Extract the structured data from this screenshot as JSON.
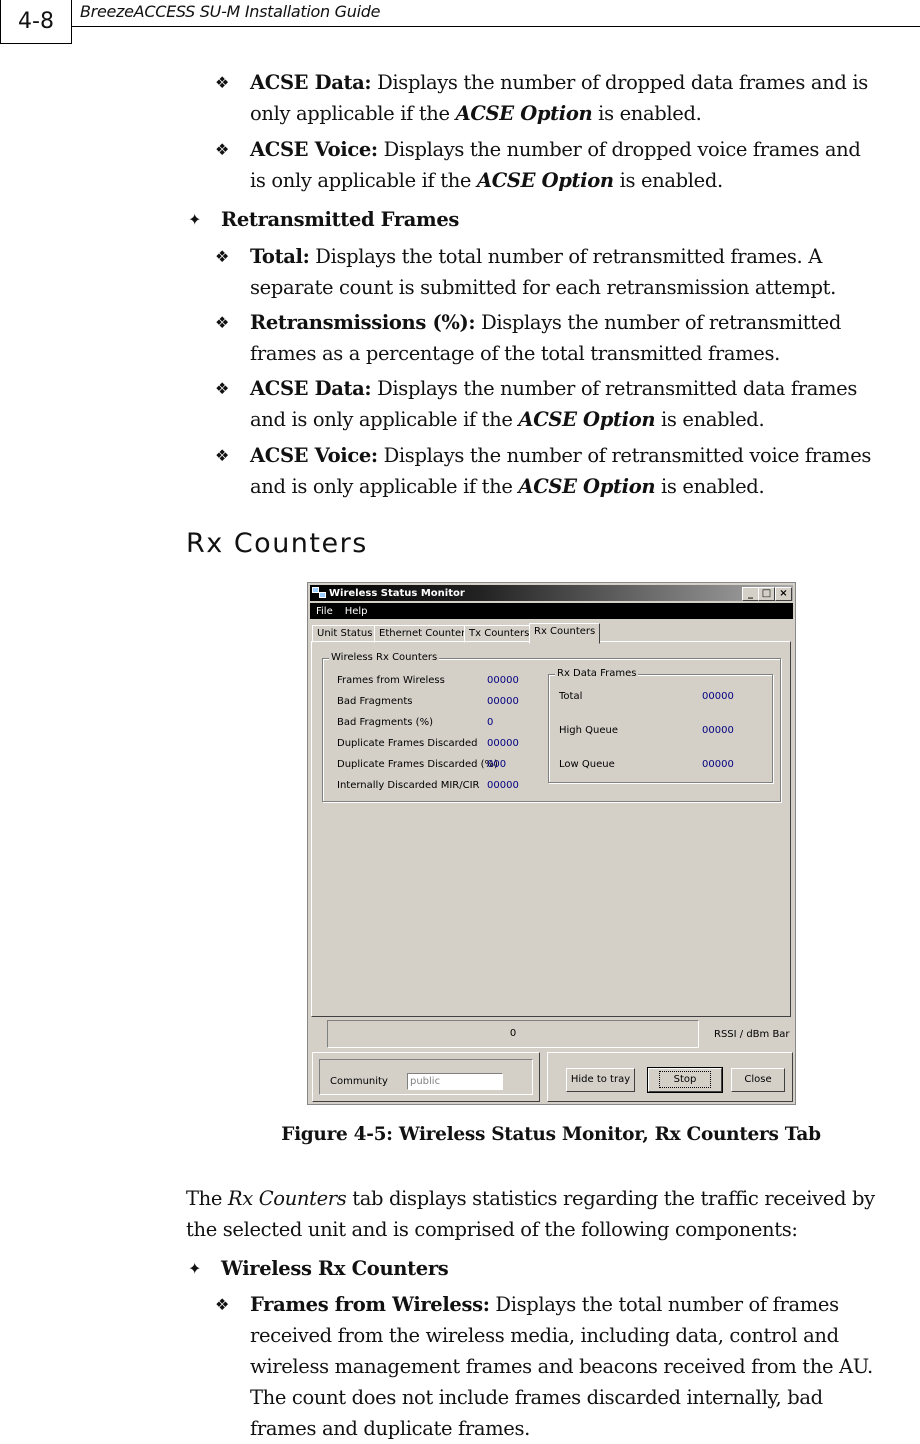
{
  "header": {
    "page_number": "4-8",
    "guide_title": "BreezeACCESS SU-M Installation Guide"
  },
  "section_top": {
    "items_dropped": [
      {
        "term": "ACSE Data:",
        "text_before": " Displays the number of dropped data frames and is",
        "line2_before": "only applicable if the ",
        "emph": "ACSE Option",
        "line2_after": " is enabled."
      },
      {
        "term": "ACSE Voice:",
        "text_before": " Displays the number of dropped voice frames and",
        "line2_before": "is only applicable if the ",
        "emph": "ACSE Option",
        "line2_after": " is enabled."
      }
    ],
    "retransmitted_heading": "Retransmitted Frames",
    "items_retransmitted": [
      {
        "term": "Total:",
        "line1": " Displays the total number of retransmitted frames. A",
        "line2": "separate count is submitted for each retransmission attempt."
      },
      {
        "term": "Retransmissions (%):",
        "line1": " Displays the number of retransmitted",
        "line2": "frames as a percentage of the total transmitted frames."
      },
      {
        "term": "ACSE Data:",
        "line1": " Displays the number of retransmitted data frames",
        "line2_before": "and is only applicable if the ",
        "emph": "ACSE Option",
        "line2_after": " is enabled."
      },
      {
        "term": "ACSE Voice:",
        "line1": " Displays the number of retransmitted voice frames",
        "line2_before": "and is only applicable if the ",
        "emph": "ACSE Option",
        "line2_after": " is enabled."
      }
    ]
  },
  "section_heading": "Rx Counters",
  "window": {
    "title": "Wireless Status Monitor",
    "controls": {
      "minimize": "_",
      "maximize": "□",
      "close": "×"
    },
    "menu": [
      "File",
      "Help"
    ],
    "tabs": [
      "Unit Status",
      "Ethernet Counters",
      "Tx Counters",
      "Rx Counters"
    ],
    "active_tab": "Rx Counters",
    "wireless_rx_counters": {
      "label": "Wireless Rx Counters",
      "rows": [
        {
          "label": "Frames from Wireless",
          "value": "00000"
        },
        {
          "label": "Bad Fragments",
          "value": "00000"
        },
        {
          "label": "Bad Fragments (%)",
          "value": "0"
        },
        {
          "label": "Duplicate Frames Discarded",
          "value": "00000"
        },
        {
          "label": "Duplicate Frames Discarded (%)",
          "value": "000"
        },
        {
          "label": "Internally Discarded MIR/CIR",
          "value": "00000"
        }
      ]
    },
    "rx_data_frames": {
      "label": "Rx Data Frames",
      "rows": [
        {
          "label": "Total",
          "value": "00000"
        },
        {
          "label": "High Queue",
          "value": "00000"
        },
        {
          "label": "Low Queue",
          "value": "00000"
        }
      ]
    },
    "rssi_value": "0",
    "rssi_label": "RSSI / dBm Bar",
    "community_label": "Community",
    "community_value": "public",
    "buttons": {
      "hide": "Hide to tray",
      "stop": "Stop",
      "close": "Close"
    },
    "value_color": "#000080"
  },
  "caption": "Figure 4-5: Wireless Status Monitor, Rx Counters Tab",
  "intro": {
    "before": "The ",
    "emph": "Rx Counters",
    "after": " tab displays statistics regarding the traffic received by",
    "line2": "the selected unit and is comprised of the following components:"
  },
  "wireless_heading": "Wireless Rx Counters",
  "frames_item": {
    "term": "Frames from Wireless:",
    "lines": [
      " Displays the total number of frames",
      "received from the wireless media, including data, control and",
      "wireless management frames and beacons received from the AU.",
      "The count does not include frames discarded internally, bad",
      "frames and duplicate frames."
    ]
  }
}
